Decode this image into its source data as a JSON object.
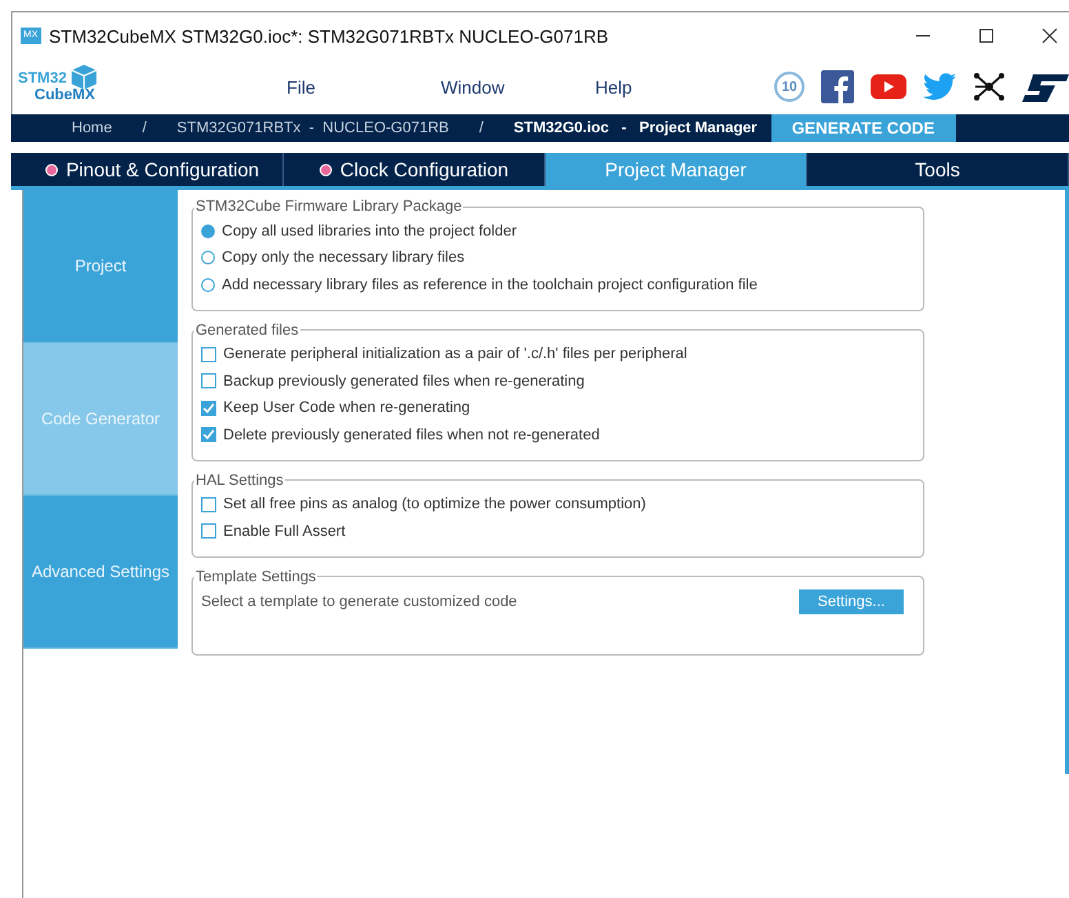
{
  "window": {
    "title": "STM32CubeMX STM32G0.ioc*: STM32G071RBTx NUCLEO-G071RB",
    "app_icon": "MX"
  },
  "logo": {
    "line1": "STM32",
    "line2": "CubeMX"
  },
  "menu": [
    "File",
    "Window",
    "Help"
  ],
  "anniversary_badge": "10",
  "breadcrumb": [
    {
      "label": "Home",
      "current": false
    },
    {
      "label": "/",
      "current": false
    },
    {
      "label": "STM32G071RBTx  -  NUCLEO-G071RB",
      "current": false
    },
    {
      "label": "/",
      "current": false
    },
    {
      "label": "STM32G0.ioc   -   Project Manager",
      "current": true
    }
  ],
  "generate_button": "GENERATE CODE",
  "tabs": [
    {
      "label": "Pinout & Configuration",
      "selected": false,
      "dot": true
    },
    {
      "label": "Clock Configuration",
      "selected": false,
      "dot": true
    },
    {
      "label": "Project Manager",
      "selected": true,
      "dot": false
    },
    {
      "label": "Tools",
      "selected": false,
      "dot": false
    }
  ],
  "sidebar": {
    "items": [
      {
        "label": "Project",
        "selected": false
      },
      {
        "label": "Code Generator",
        "selected": true
      },
      {
        "label": "Advanced Settings",
        "selected": false
      }
    ]
  },
  "groups": [
    {
      "title": "STM32Cube Firmware Library Package",
      "options": [
        {
          "kind": "radio",
          "label": "Copy all used libraries into the project folder",
          "checked": true
        },
        {
          "kind": "radio",
          "label": "Copy only the necessary library files",
          "checked": false
        },
        {
          "kind": "radio",
          "label": "Add necessary library files as reference in the toolchain project configuration file",
          "checked": false
        }
      ]
    },
    {
      "title": "Generated files",
      "options": [
        {
          "kind": "checkbox",
          "label": "Generate peripheral initialization as a pair of '.c/.h' files per peripheral",
          "checked": false
        },
        {
          "kind": "checkbox",
          "label": "Backup previously generated files when re-generating",
          "checked": false
        },
        {
          "kind": "checkbox",
          "label": "Keep User Code when re-generating",
          "checked": true
        },
        {
          "kind": "checkbox",
          "label": "Delete previously generated files when not re-generated",
          "checked": true
        }
      ]
    },
    {
      "title": "HAL Settings",
      "options": [
        {
          "kind": "checkbox",
          "label": "Set all free pins as analog (to optimize the power consumption)",
          "checked": false
        },
        {
          "kind": "checkbox",
          "label": "Enable Full Assert",
          "checked": false
        }
      ]
    },
    {
      "title": "Template Settings",
      "options": [
        {
          "kind": "text",
          "label": "Select a template to generate customized code",
          "button": "Settings..."
        }
      ]
    }
  ]
}
